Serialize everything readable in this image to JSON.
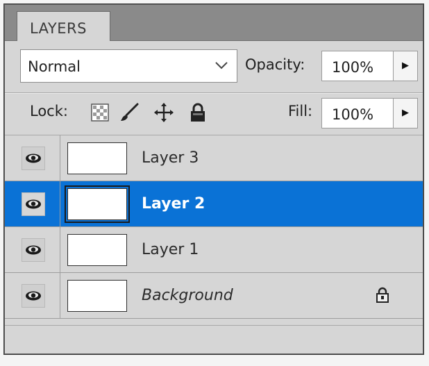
{
  "panel": {
    "tab_label": "LAYERS",
    "blend_mode": "Normal",
    "opacity_label": "Opacity:",
    "opacity_value": "100%",
    "lock_label": "Lock:",
    "fill_label": "Fill:",
    "fill_value": "100%",
    "lock_icons": [
      "transparent-pixels-lock-icon",
      "brush-lock-icon",
      "move-lock-icon",
      "padlock-icon"
    ]
  },
  "layers": [
    {
      "name": "Layer 3",
      "visible": true,
      "selected": false,
      "locked": false
    },
    {
      "name": "Layer 2",
      "visible": true,
      "selected": true,
      "locked": false
    },
    {
      "name": "Layer 1",
      "visible": true,
      "selected": false,
      "locked": false
    },
    {
      "name": "Background",
      "visible": true,
      "selected": false,
      "locked": true
    }
  ],
  "colors": {
    "panel_bg": "#d6d6d6",
    "selected_row": "#0a72d6",
    "tab_strip": "#8a8a8a"
  }
}
